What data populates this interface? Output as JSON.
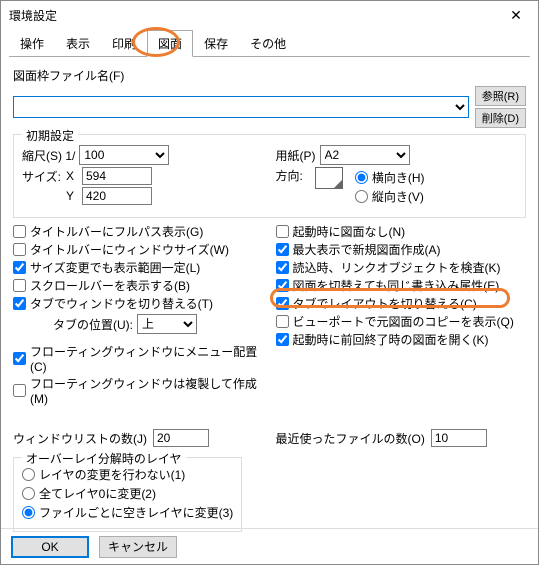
{
  "window": {
    "title": "環境設定"
  },
  "tabs": [
    "操作",
    "表示",
    "印刷",
    "図面",
    "保存",
    "その他"
  ],
  "file": {
    "label": "図面枠ファイル名(F)",
    "browse": "参照(R)",
    "delete": "削除(D)"
  },
  "group": {
    "title": "初期設定"
  },
  "scale": {
    "label": "縮尺(S) 1/",
    "value": "100"
  },
  "size": {
    "label": "サイズ:",
    "x_label": "X",
    "y_label": "Y",
    "x": "594",
    "y": "420"
  },
  "paper": {
    "label": "用紙(P)",
    "value": "A2"
  },
  "orient": {
    "label": "方向:",
    "landscape": "横向き(H)",
    "portrait": "縦向き(V)"
  },
  "left_checks": [
    "タイトルバーにフルパス表示(G)",
    "タイトルバーにウィンドウサイズ(W)",
    "サイズ変更でも表示範囲一定(L)",
    "スクロールバーを表示する(B)",
    "タブでウィンドウを切り替える(T)"
  ],
  "tab_pos": {
    "label": "タブの位置(U):",
    "value": "上"
  },
  "left_checks2": [
    "フローティングウィンドウにメニュー配置(C)",
    "フローティングウィンドウは複製して作成(M)"
  ],
  "right_checks": [
    "起動時に図面なし(N)",
    "最大表示で新規図面作成(A)",
    "読込時、リンクオブジェクトを検査(K)",
    "図面を切替えても同じ書き込み属性(E)",
    "タブでレイアウトを切り替える(C)",
    "ビューポートで元図面のコピーを表示(Q)",
    "起動時に前回終了時の図面を開く(K)"
  ],
  "winlist": {
    "label": "ウィンドウリストの数(J)",
    "value": "20"
  },
  "recent": {
    "label": "最近使ったファイルの数(O)",
    "value": "10"
  },
  "overlay": {
    "title": "オーバーレイ分解時のレイヤ",
    "opts": [
      "レイヤの変更を行わない(1)",
      "全てレイヤ0に変更(2)",
      "ファイルごとに空きレイヤに変更(3)"
    ]
  },
  "footer": {
    "ok": "OK",
    "cancel": "キャンセル"
  }
}
